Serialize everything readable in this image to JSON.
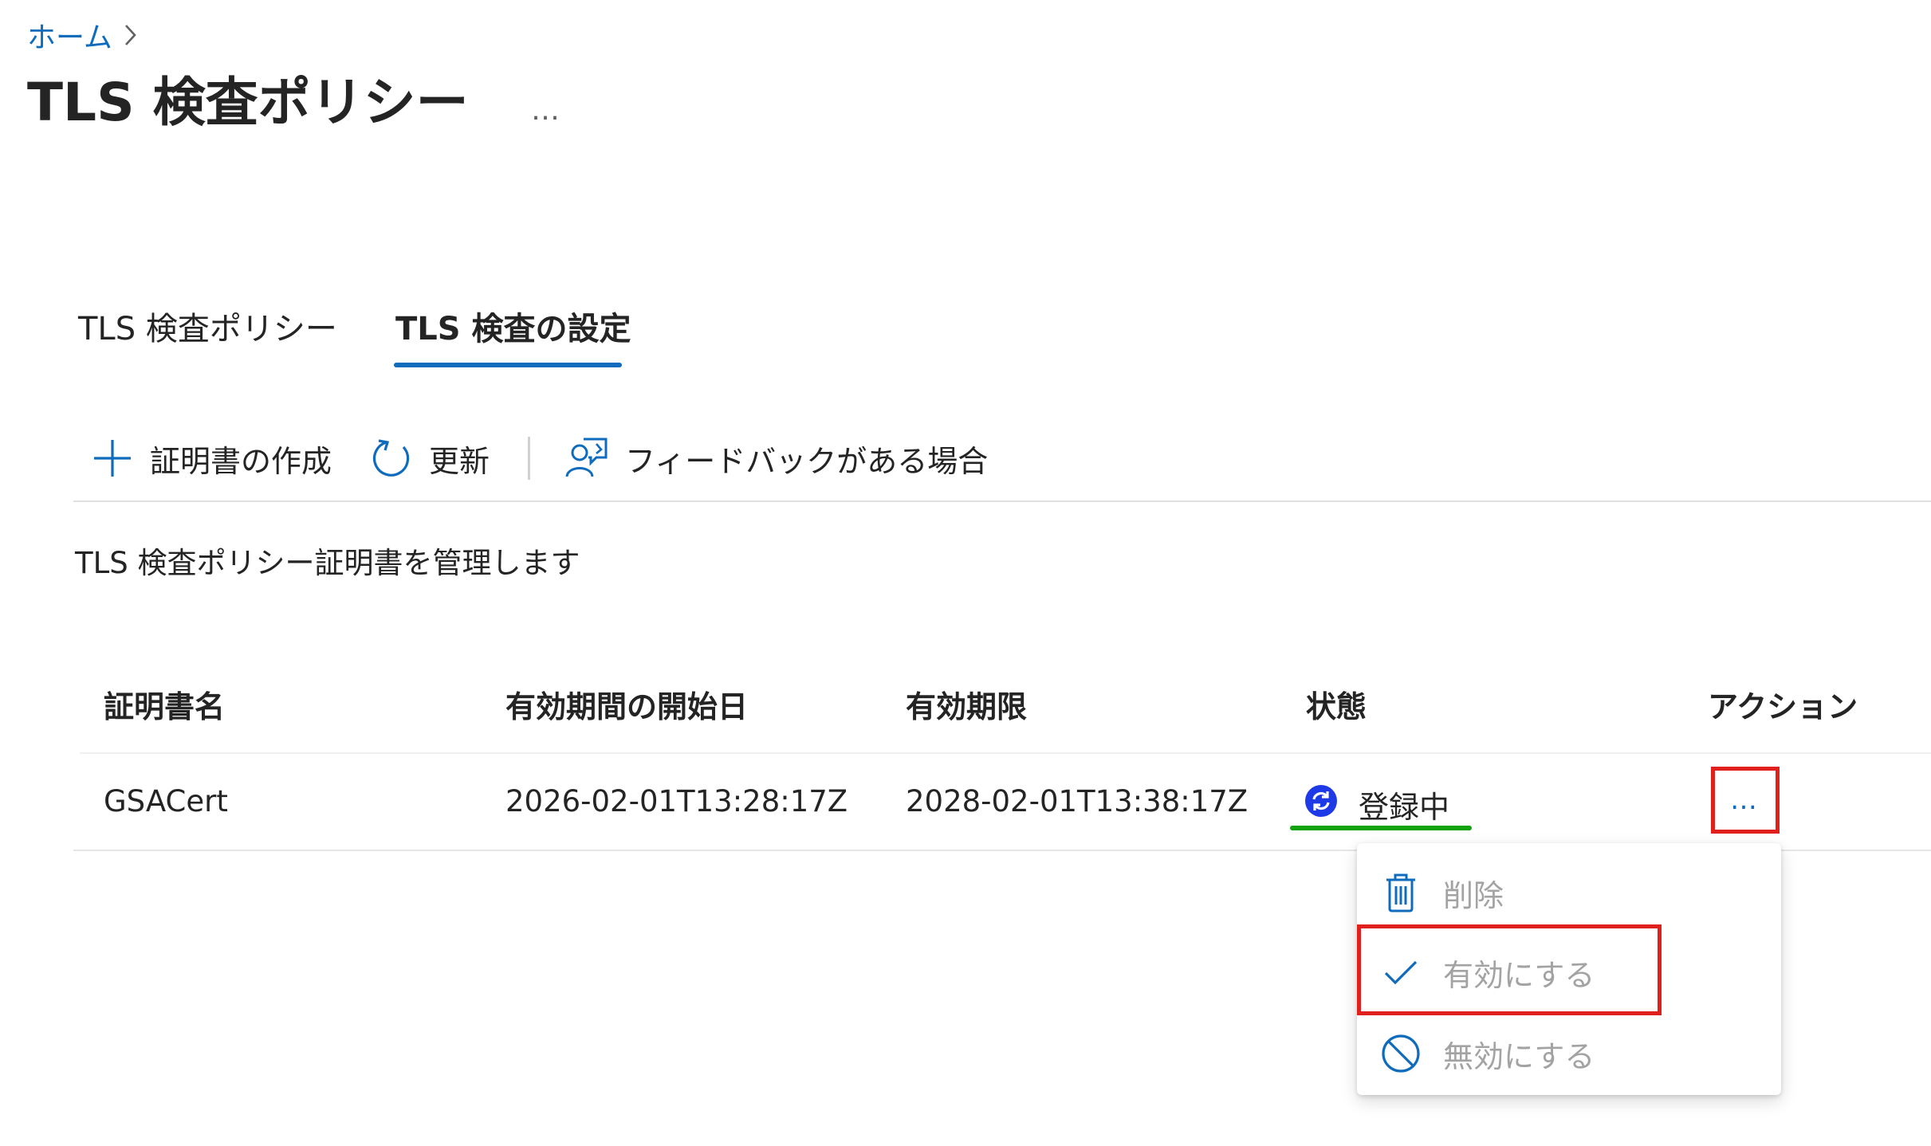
{
  "breadcrumb": {
    "home": "ホーム",
    "separator_icon": "chevron-right-icon"
  },
  "page": {
    "title": "TLS 検査ポリシー",
    "more": "…"
  },
  "tabs": [
    {
      "label": "TLS 検査ポリシー",
      "active": false
    },
    {
      "label": "TLS 検査の設定",
      "active": true
    }
  ],
  "toolbar": {
    "create_label": "証明書の作成",
    "create_icon": "plus-icon",
    "refresh_label": "更新",
    "refresh_icon": "refresh-icon",
    "feedback_label": "フィードバックがある場合",
    "feedback_icon": "feedback-person-icon"
  },
  "description": "TLS 検査ポリシー証明書を管理します",
  "table": {
    "headers": [
      "証明書名",
      "有効期間の開始日",
      "有効期限",
      "状態",
      "アクション"
    ],
    "rows": [
      {
        "name": "GSACert",
        "start": "2026-02-01T13:28:17Z",
        "expiry": "2028-02-01T13:38:17Z",
        "status": "登録中",
        "status_icon": "sync-circle-icon",
        "action": "…"
      }
    ]
  },
  "context_menu": {
    "items": [
      {
        "label": "削除",
        "icon": "trash-icon"
      },
      {
        "label": "有効にする",
        "icon": "checkmark-icon"
      },
      {
        "label": "無効にする",
        "icon": "block-icon"
      }
    ]
  },
  "colors": {
    "accent": "#0f6cbd",
    "status_underline": "#13a10e",
    "highlight": "#e0201c",
    "status_icon": "#1e3ae6",
    "menu_text_disabled": "#a3a3a3"
  }
}
